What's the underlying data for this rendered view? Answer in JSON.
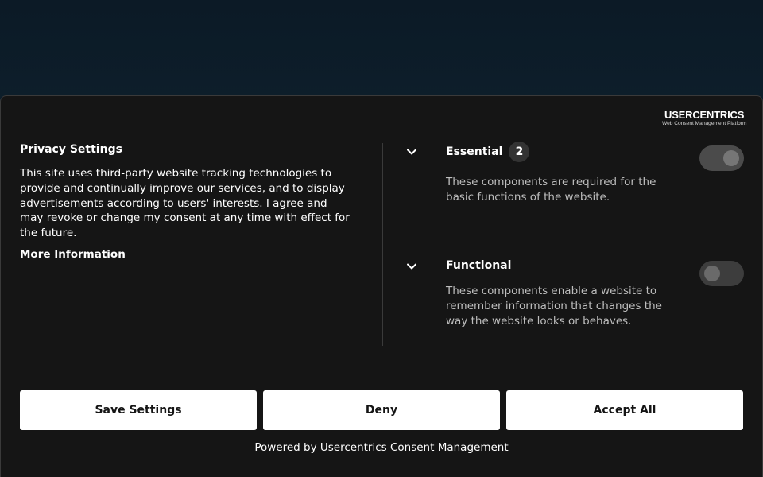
{
  "colors": {
    "panel_bg": "#151515",
    "button_bg": "#ffffff",
    "button_text": "#151515",
    "muted_text": "#bdbdbd",
    "toggle_off": "#3d3d3d"
  },
  "branding": {
    "name": "USERCENTRICS",
    "tagline": "Web Consent Management Platform",
    "icon": "usercentrics-shield-icon"
  },
  "intro": {
    "title": "Privacy Settings",
    "description": "This site uses third-party website tracking technologies to provide and continually improve our services, and to display advertisements according to users' interests. I agree and may revoke or change my consent at any time with effect for the future.",
    "more_link": "More Information"
  },
  "categories": [
    {
      "name": "Essential",
      "count": "2",
      "description": "These components are required for the basic functions of the website.",
      "enabled": true,
      "locked": true,
      "icon": "chevron-down-icon"
    },
    {
      "name": "Functional",
      "description": "These components enable a website to remember information that changes the way the website looks or behaves.",
      "enabled": false,
      "locked": false,
      "icon": "chevron-down-icon"
    }
  ],
  "actions": {
    "save_label": "Save Settings",
    "deny_label": "Deny",
    "accept_label": "Accept All"
  },
  "footer": {
    "powered_by": "Powered by Usercentrics Consent Management"
  }
}
